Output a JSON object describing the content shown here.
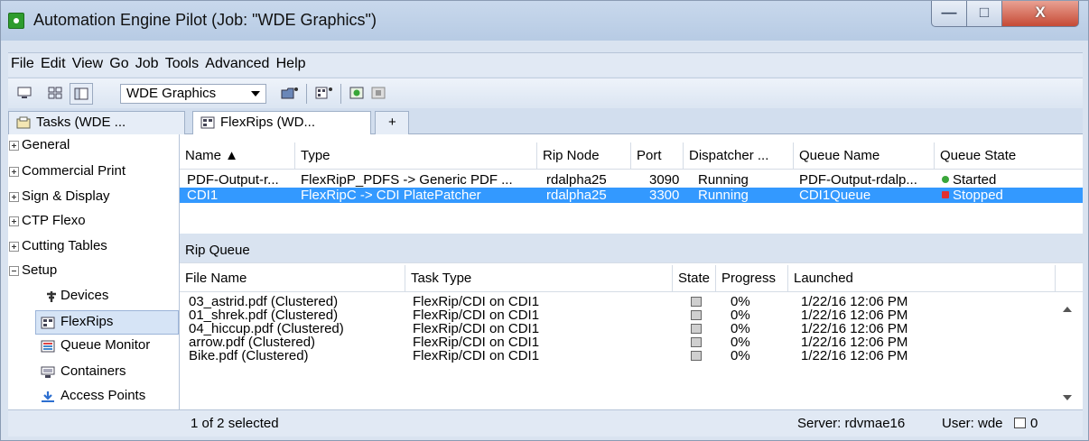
{
  "window": {
    "title": "Automation Engine Pilot (Job: \"WDE Graphics\")",
    "minimize": "—",
    "maximize": "□",
    "close": "X"
  },
  "menu": [
    "File",
    "Edit",
    "View",
    "Go",
    "Job",
    "Tools",
    "Advanced",
    "Help"
  ],
  "toolbar": {
    "job_combo": "WDE Graphics",
    "icons": [
      "monitor-icon",
      "grid-view-icon",
      "panel-icon",
      "folder-add-icon",
      "flexrip-add-icon",
      "start-icon",
      "stop-icon"
    ]
  },
  "tabs": [
    {
      "label": "Tasks (WDE ...",
      "icon": "tasks-icon"
    },
    {
      "label": "FlexRips (WD...",
      "icon": "flexrips-icon"
    },
    {
      "label": "+"
    }
  ],
  "sidebar": {
    "items": [
      {
        "label": "General",
        "expander": "+"
      },
      {
        "label": "Commercial Print",
        "expander": "+"
      },
      {
        "label": "Sign & Display",
        "expander": "+"
      },
      {
        "label": "CTP Flexo",
        "expander": "+"
      },
      {
        "label": "Cutting Tables",
        "expander": "+"
      },
      {
        "label": "Setup",
        "expander": "-"
      }
    ],
    "children": [
      {
        "label": "Devices",
        "icon": "devices-icon"
      },
      {
        "label": "FlexRips",
        "icon": "flexrips-icon"
      },
      {
        "label": "Queue Monitor",
        "icon": "queue-monitor-icon"
      },
      {
        "label": "Containers",
        "icon": "containers-icon"
      },
      {
        "label": "Access Points",
        "icon": "access-points-icon"
      }
    ]
  },
  "rips": {
    "columns": [
      "Name ▲",
      "Type",
      "Rip Node",
      "Port",
      "Dispatcher ...",
      "Queue Name",
      "Queue State"
    ],
    "rows": [
      {
        "name": "PDF-Output-r...",
        "type": "FlexRipP_PDFS -> Generic PDF ...",
        "node": "rdalpha25",
        "port": "3090",
        "dispatcher": "Running",
        "queue": "PDF-Output-rdalp...",
        "state": "Started",
        "state_color": "#3aa63a"
      },
      {
        "name": "CDI1",
        "type": "FlexRipC -> CDI PlatePatcher",
        "node": "rdalpha25",
        "port": "3300",
        "dispatcher": "Running",
        "queue": "CDI1Queue",
        "state": "Stopped",
        "state_color": "#e03030"
      }
    ]
  },
  "ripqueue": {
    "label": "Rip Queue",
    "columns": [
      "File Name",
      "Task Type",
      "State",
      "Progress",
      "Launched"
    ],
    "rows": [
      {
        "file": "03_astrid.pdf (Clustered)",
        "task": "FlexRip/CDI on CDI1",
        "progress": "0%",
        "launched": "1/22/16 12:06 PM"
      },
      {
        "file": "01_shrek.pdf (Clustered)",
        "task": "FlexRip/CDI on CDI1",
        "progress": "0%",
        "launched": "1/22/16 12:06 PM"
      },
      {
        "file": "04_hiccup.pdf (Clustered)",
        "task": "FlexRip/CDI on CDI1",
        "progress": "0%",
        "launched": "1/22/16 12:06 PM"
      },
      {
        "file": "arrow.pdf (Clustered)",
        "task": "FlexRip/CDI on CDI1",
        "progress": "0%",
        "launched": "1/22/16 12:06 PM"
      },
      {
        "file": "Bike.pdf (Clustered)",
        "task": "FlexRip/CDI on CDI1",
        "progress": "0%",
        "launched": "1/22/16 12:06 PM"
      }
    ]
  },
  "status": {
    "selection": "1 of 2 selected",
    "server": "Server: rdvmae16",
    "user": "User: wde",
    "count": "0"
  },
  "colors": {
    "selection": "#3399ff",
    "started": "#3aa63a",
    "stopped": "#e03030"
  }
}
